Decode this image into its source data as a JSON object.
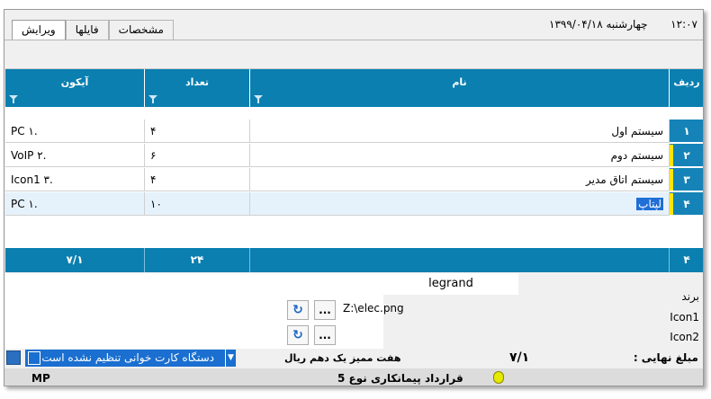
{
  "header": {
    "time": "۱۲:۰۷",
    "date": "چهارشنبه ۱۳۹۹/۰۴/۱۸",
    "tabs": [
      {
        "label": "ویرایش",
        "active": true
      },
      {
        "label": "فایلها",
        "active": false
      },
      {
        "label": "مشخصات",
        "active": false
      }
    ]
  },
  "grid": {
    "columns": {
      "row": "ردیف",
      "name": "نام",
      "count": "تعداد",
      "icon": "آیکون"
    },
    "rows": [
      {
        "num": "۱",
        "name": "سیستم اول",
        "count": "۴",
        "icon": "PC ۱."
      },
      {
        "num": "۲",
        "name": "سیستم دوم",
        "count": "۶",
        "icon": "VoIP ۲."
      },
      {
        "num": "۳",
        "name": "سیستم اتاق مدیر",
        "count": "۴",
        "icon": "Icon1 ۳."
      },
      {
        "num": "۴",
        "name": "لپتاپ",
        "count": "۱۰",
        "icon": "PC ۱."
      }
    ],
    "footer": {
      "row": "۴",
      "count": "۲۴",
      "icon": "۷/۱"
    }
  },
  "form": {
    "brand_label": "برند",
    "brand_value": "legrand",
    "icon1_label": "Icon1",
    "icon1_path": "Z:\\elec.png",
    "icon2_label": "Icon2",
    "browse_label": "...",
    "refresh_symbol": "↻"
  },
  "status": {
    "card_reader": "دستگاه کارت خوانی تنظیم نشده است",
    "amount_words": "هفت  ممیز یک دهم ریال",
    "amount": "۷/۱",
    "amount_label": "مبلغ نهایی :",
    "contract": "قرارداد پیمانکاری نوع 5",
    "mp": "MP"
  },
  "colors": {
    "header_blue": "#0a7fb0",
    "selection": "#1f6fd6",
    "row_marker": "#ffe600"
  }
}
